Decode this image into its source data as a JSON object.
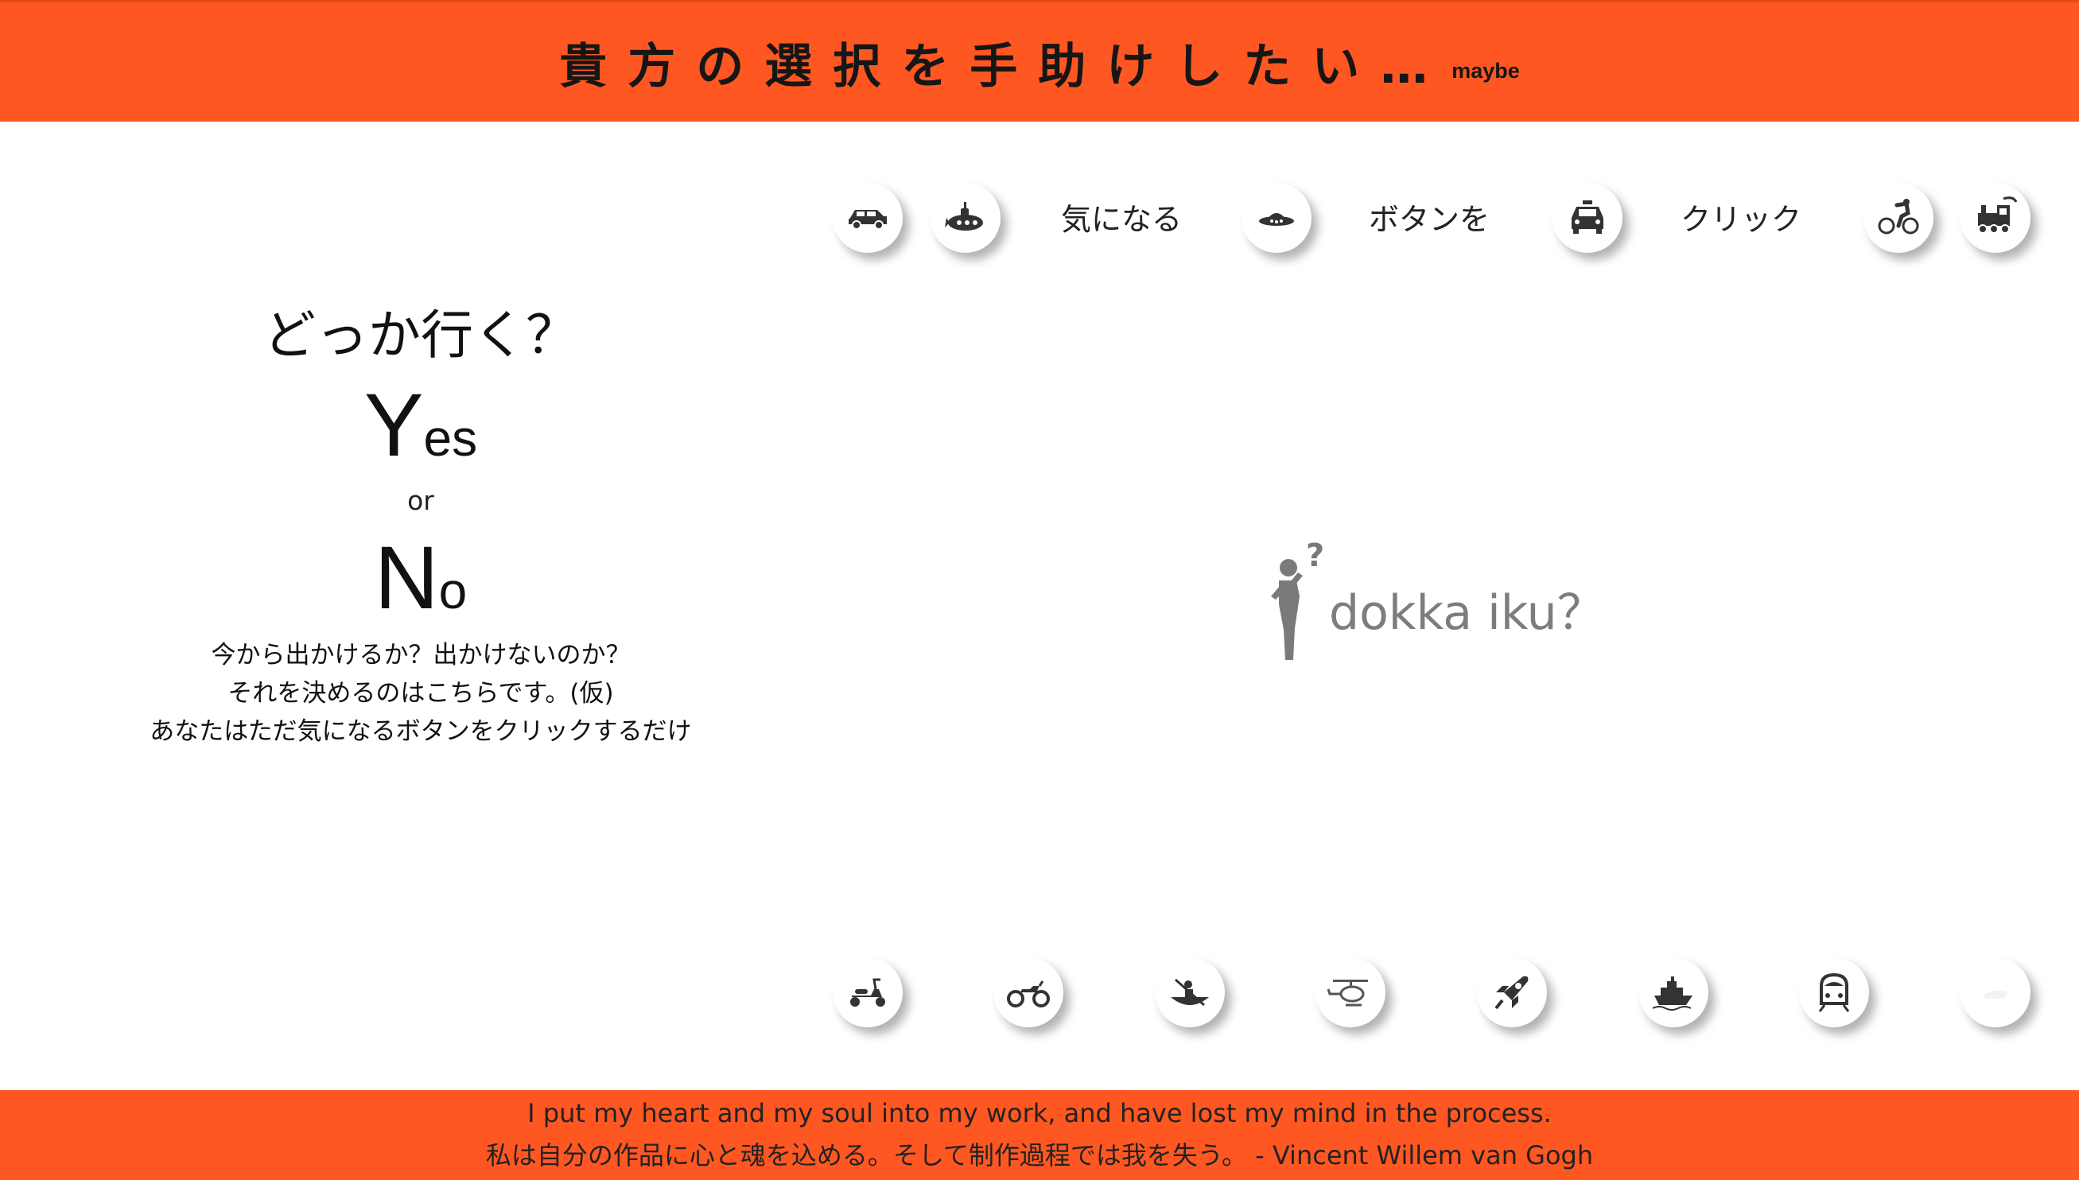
{
  "header": {
    "title": "貴方の選択を手助けしたい…",
    "suffix": "maybe",
    "color": "#ff5722"
  },
  "left": {
    "question": "どっか行く？",
    "yes_big": "Y",
    "yes_small": "es",
    "or": "or",
    "no_big": "N",
    "no_small": "o",
    "desc_lines": [
      "今から出かけるか？出かけないのか？",
      "それを決めるのはこちらです。(仮)",
      "あなたはただ気になるボタンをクリックするだけ"
    ]
  },
  "top_row": {
    "icons": [
      "suv-icon",
      "submarine-icon",
      "ufo-icon",
      "taxi-icon",
      "cyclist-icon",
      "train-icon"
    ],
    "words": [
      "気になる",
      "ボタンを",
      "クリック"
    ]
  },
  "center": {
    "text": "dokka iku？",
    "icon": "thinking-person-icon"
  },
  "bottom_row": {
    "icons": [
      "scooter-icon",
      "motorcycle-icon",
      "canoe-icon",
      "helicopter-icon",
      "rocket-icon",
      "ship-icon",
      "bullet-train-icon",
      "faded-icon"
    ]
  },
  "footer": {
    "quote_en": "I put my heart and my soul into my work, and have lost my mind in the process.",
    "quote_ja": "私は自分の作品に心と魂を込める。そして制作過程では我を失う。 - Vincent Willem van Gogh"
  }
}
